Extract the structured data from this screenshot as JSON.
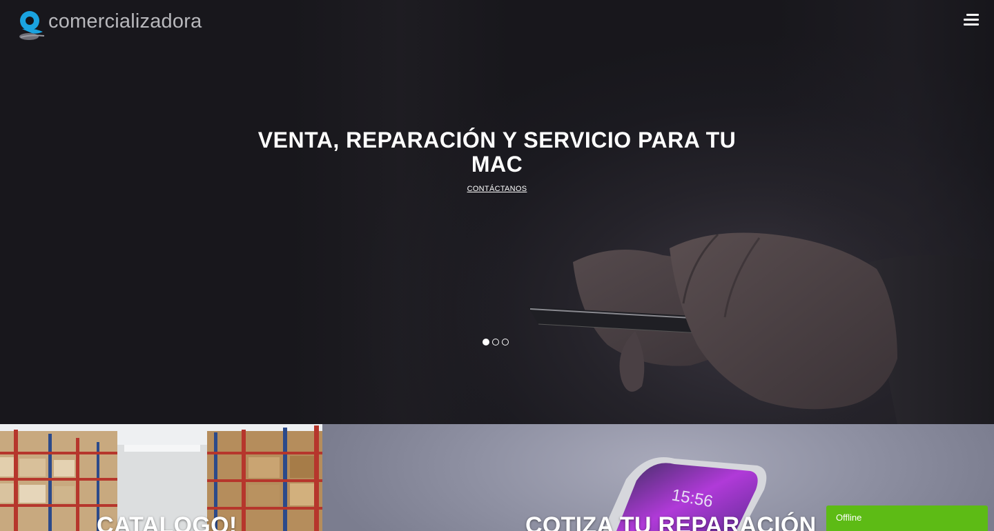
{
  "header": {
    "logo_text": "comercializadora",
    "logo_color": "#1aa3e0"
  },
  "hero": {
    "title": "VENTA, REPARACIÓN Y SERVICIO PARA TU MAC",
    "cta": "CONTÁCTANOS",
    "slides": 3,
    "active_slide": 1
  },
  "panels": {
    "left_label": "CATALOGO!",
    "right_label": "COTIZA TU REPARACIÓN"
  },
  "chat": {
    "status": "Offline",
    "color": "#5dbb15"
  }
}
